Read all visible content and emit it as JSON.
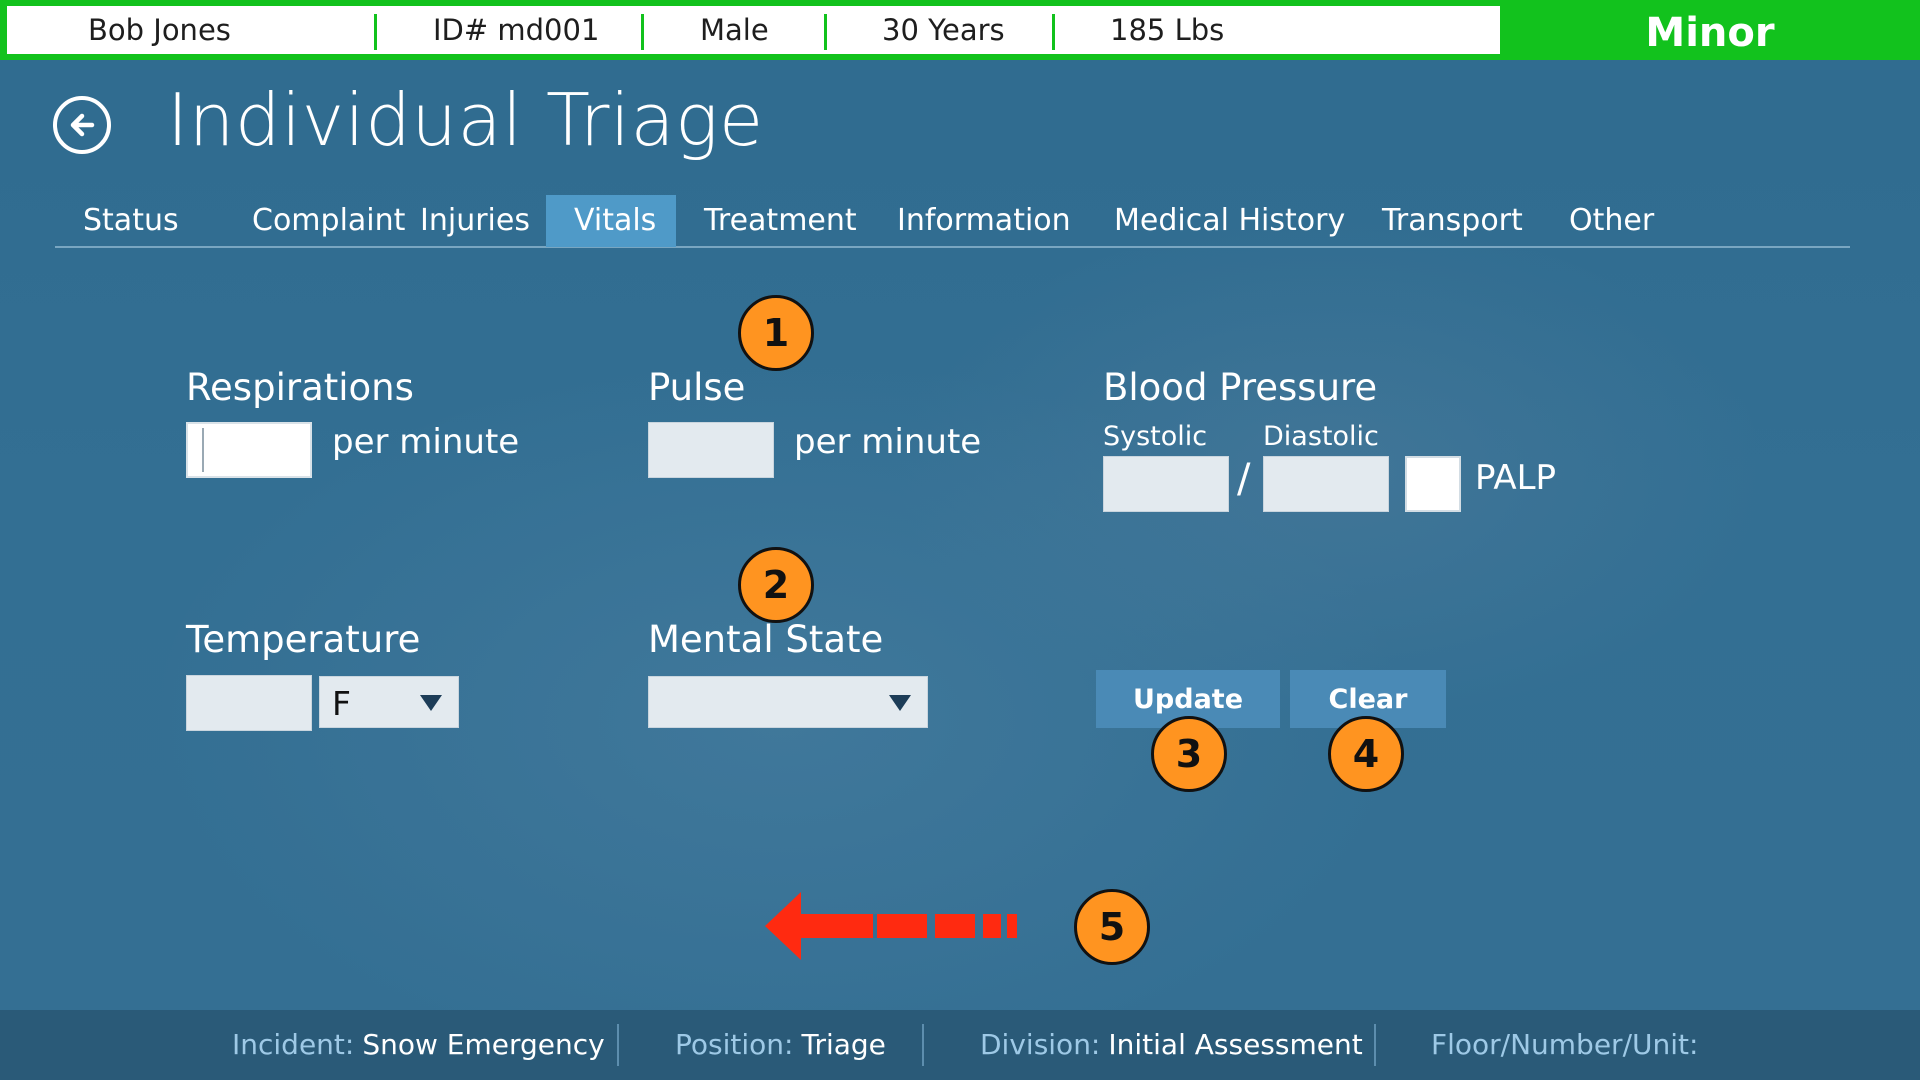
{
  "patient": {
    "name": "Bob  Jones",
    "id": "ID# md001",
    "sex": "Male",
    "age": "30 Years",
    "weight": "185 Lbs",
    "severity": "Minor",
    "severity_color": "#12c21d"
  },
  "header": {
    "title": "Individual Triage",
    "back_icon": "back-arrow-icon"
  },
  "tabs": [
    {
      "label": "Status",
      "active": false
    },
    {
      "label": "Complaint",
      "active": false
    },
    {
      "label": "Injuries",
      "active": false
    },
    {
      "label": "Vitals",
      "active": true
    },
    {
      "label": "Treatment",
      "active": false
    },
    {
      "label": "Information",
      "active": false
    },
    {
      "label": "Medical History",
      "active": false
    },
    {
      "label": "Transport",
      "active": false
    },
    {
      "label": "Other",
      "active": false
    }
  ],
  "vitals": {
    "respirations": {
      "label": "Respirations",
      "value": "",
      "unit": "per minute"
    },
    "pulse": {
      "label": "Pulse",
      "value": "",
      "unit": "per minute"
    },
    "blood_pressure": {
      "label": "Blood Pressure",
      "systolic_label": "Systolic",
      "diastolic_label": "Diastolic",
      "systolic": "",
      "diastolic": "",
      "separator": "/",
      "palp_label": "PALP",
      "palp_checked": false
    },
    "temperature": {
      "label": "Temperature",
      "value": "",
      "unit_selected": "F"
    },
    "mental_state": {
      "label": "Mental State",
      "selected": ""
    }
  },
  "actions": {
    "update_label": "Update",
    "clear_label": "Clear"
  },
  "annotations": [
    "1",
    "2",
    "3",
    "4",
    "5"
  ],
  "annotation_color": "#ff9420",
  "arrow_color": "#ff2a10",
  "status_bar": {
    "incident_key": "Incident:",
    "incident_value": "Snow Emergency",
    "position_key": "Position:",
    "position_value": "Triage",
    "division_key": "Division:",
    "division_value": "Initial Assessment",
    "floor_key": "Floor/Number/Unit:",
    "floor_value": ""
  }
}
